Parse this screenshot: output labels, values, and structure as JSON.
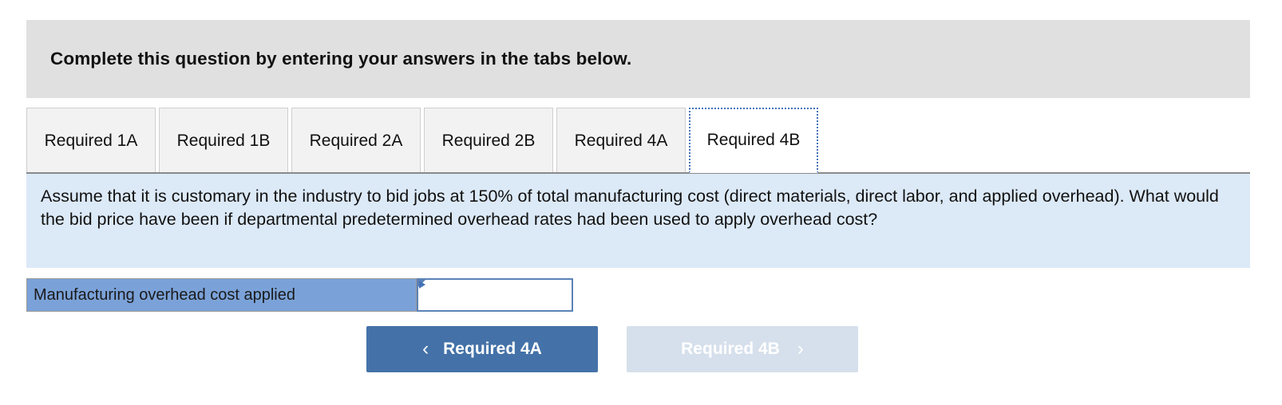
{
  "header": {
    "title": "Complete this question by entering your answers in the tabs below."
  },
  "tabs": [
    {
      "label": "Required 1A",
      "active": false
    },
    {
      "label": "Required 1B",
      "active": false
    },
    {
      "label": "Required 2A",
      "active": false
    },
    {
      "label": "Required 2B",
      "active": false
    },
    {
      "label": "Required 4A",
      "active": false
    },
    {
      "label": "Required 4B",
      "active": true
    }
  ],
  "question": {
    "text": "Assume that it is customary in the industry to bid jobs at 150% of total manufacturing cost (direct materials, direct labor, and applied overhead). What would the bid price have been if departmental predetermined overhead rates had been used to apply overhead cost?"
  },
  "answer": {
    "label": "Manufacturing overhead cost applied",
    "value": "",
    "placeholder": ""
  },
  "navigation": {
    "prev_label": "Required 4A",
    "prev_icon": "chevron-left-icon",
    "prev_chevron": "‹",
    "next_label": "Required 4B",
    "next_icon": "chevron-right-icon",
    "next_chevron": "›"
  },
  "colors": {
    "header_band": "#e0e0e0",
    "question_panel": "#dce9f7",
    "answer_label": "#7ba2d8",
    "input_border": "#5b82b8",
    "button_primary": "#4472a8",
    "button_disabled": "#d6e0ec",
    "tab_inactive": "#f2f2f2",
    "tab_active": "#ffffff",
    "tab_focus_outline": "#4472b8"
  }
}
